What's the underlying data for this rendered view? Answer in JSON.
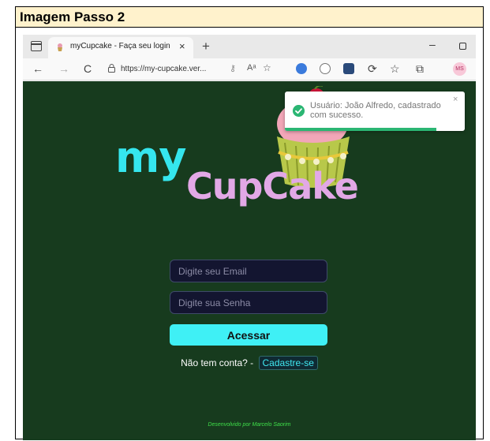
{
  "caption": "Imagem Passo 2",
  "browser": {
    "tab_title": "myCupcake - Faça seu login",
    "tab_close": "×",
    "new_tab": "+",
    "minimize": "–",
    "url": "https://my-cupcake.ver...",
    "back": "←",
    "forward": "→",
    "refresh": "C",
    "read_aloud": "Aᵃ",
    "profile_initials": "MS"
  },
  "page": {
    "logo_my": "my",
    "logo_cupcake": "CupCake",
    "email_placeholder": "Digite seu Email",
    "password_placeholder": "Digite sua Senha",
    "login_button": "Acessar",
    "no_account_text": "Não tem conta? -",
    "signup_link": "Cadastre-se",
    "footer": "Desenvolvido por Marcelo Saorim"
  },
  "toast": {
    "message": "Usuário: João Alfredo, cadastrado com sucesso.",
    "close": "×",
    "progress": 0.84
  },
  "colors": {
    "page_bg": "#173b1e",
    "accent_cyan": "#3ff0f5",
    "logo_pink": "#e2a8e6",
    "toast_green": "#2bb673",
    "footer_green": "#3fe04a"
  }
}
